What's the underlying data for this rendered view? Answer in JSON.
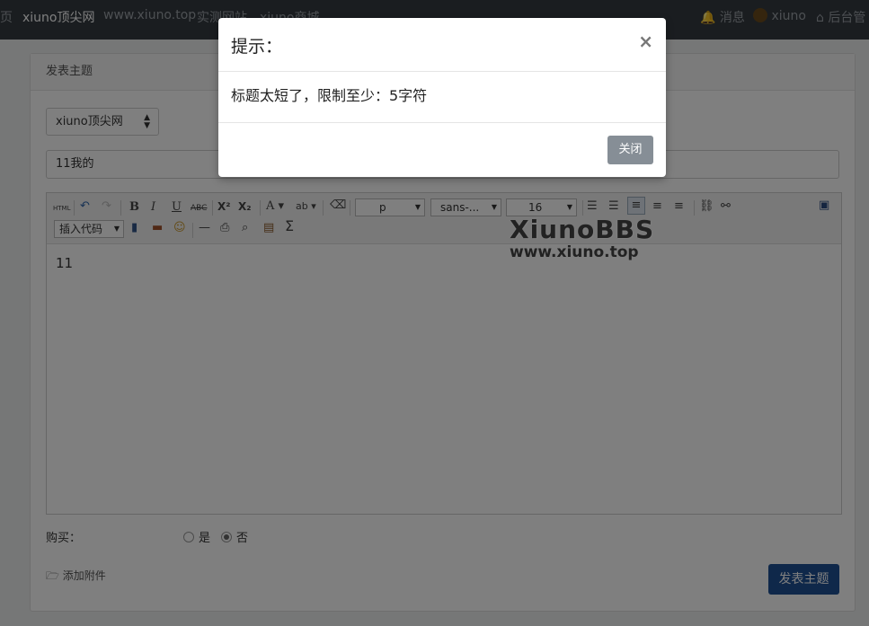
{
  "nav": {
    "items": [
      "页",
      "xiuno顶尖网",
      "www.xiuno.top",
      "实测网站",
      "xiuno商城"
    ],
    "right": {
      "messages": "消息",
      "user": "xiuno",
      "admin": "后台管"
    }
  },
  "page": {
    "card_title": "发表主题",
    "forum_select": "xiuno顶尖网",
    "title_value": "11我的",
    "editor": {
      "html_label": "HTML",
      "paragraph": "p",
      "font": "sans-...",
      "size": "16",
      "insert_code": "插入代码",
      "content": "11"
    },
    "watermark": {
      "line1": "XiunoBBS",
      "line2": "www.xiuno.top"
    },
    "buy_label": "购买：",
    "buy_options": [
      "是",
      "否"
    ],
    "buy_selected": "否",
    "attach_label": "添加附件",
    "submit_label": "发表主题"
  },
  "modal": {
    "title": "提示：",
    "message": "标题太短了，限制至少：5字符",
    "close_label": "关闭"
  }
}
